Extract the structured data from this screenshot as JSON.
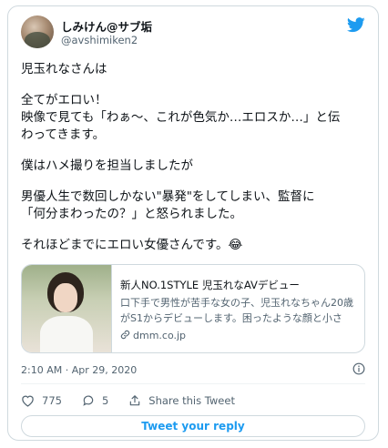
{
  "author": {
    "display_name": "しみけん@サブ垢",
    "handle": "@avshimiken2"
  },
  "tweet": {
    "paragraphs": [
      [
        "児玉れなさんは"
      ],
      [
        "全てがエロい！",
        "映像で見ても「わぁ～、これが色気か…エロスか…」と伝",
        "わってきます。"
      ],
      [
        "僕はハメ撮りを担当しましたが"
      ],
      [
        "男優人生で数回しかない\"暴発\"をしてしまい、監督に",
        "「何分まわったの？」と怒られました。"
      ],
      [
        "それほどまでにエロい女優さんです。😂"
      ]
    ]
  },
  "link_card": {
    "title": "新人NO.1STYLE 児玉れなAVデビュー",
    "description": "口下手で男性が苦手な女の子、児玉れなちゃん20歳がS1からデビューします。困ったような顔と小さな…",
    "domain": "dmm.co.jp"
  },
  "timestamp": "2:10 AM · Apr 29, 2020",
  "actions": {
    "like_count": "775",
    "reply_count": "5",
    "share_label": "Share this Tweet"
  },
  "reply_button_label": "Tweet your reply",
  "colors": {
    "brand": "#1d9bf0",
    "like": "#536471",
    "border": "#cfd9de",
    "text": "#0f1419",
    "secondary_text": "#536471"
  }
}
